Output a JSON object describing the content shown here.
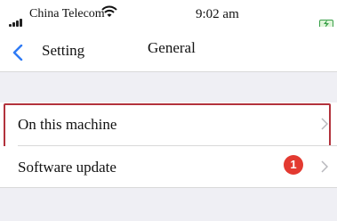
{
  "status_bar": {
    "carrier": "China Telecom",
    "time": "9:02 am",
    "signal_icon": "signal-bars-icon",
    "wifi_icon": "wifi-icon",
    "battery_icon": "battery-charging-icon",
    "battery_color": "#3aa04a"
  },
  "nav": {
    "back_label": "Setting",
    "title": "General",
    "back_icon": "chevron-left-icon",
    "accent": "#2f7bf5"
  },
  "rows": [
    {
      "label": "On this machine",
      "chevron_icon": "chevron-right-icon"
    },
    {
      "label": "Software update",
      "badge": "1",
      "chevron_icon": "chevron-right-icon"
    }
  ],
  "highlight_color": "#b2323c",
  "badge_color": "#e33a31"
}
